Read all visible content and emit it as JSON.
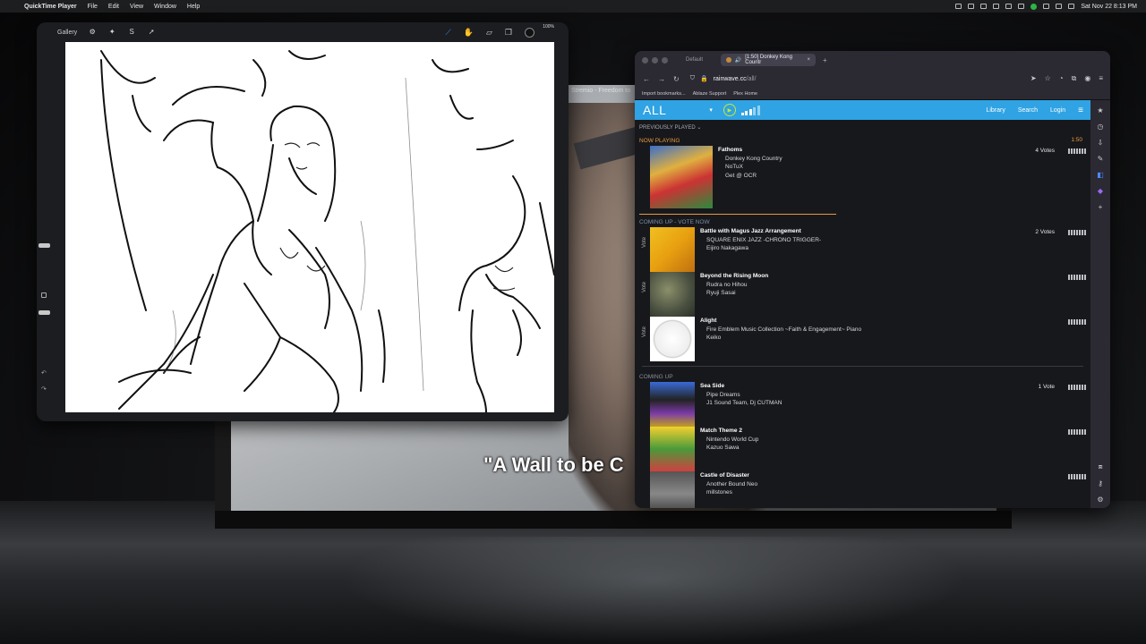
{
  "menubar": {
    "app": "QuickTime Player",
    "items": [
      "File",
      "Edit",
      "View",
      "Window",
      "Help"
    ],
    "clock": "Sat Nov 22  8:13 PM"
  },
  "video": {
    "title": "Stremio - Freedom to",
    "subtitle": "\"A Wall to be C"
  },
  "procreate": {
    "gallery": "Gallery",
    "battery": "100%"
  },
  "browser": {
    "tabs": [
      {
        "label": "Default"
      },
      {
        "label": "[1:50] Donkey Kong Countr"
      }
    ],
    "url_host": "rainwave.cc",
    "url_path": "/all/",
    "bookmarks": [
      "Import bookmarks...",
      "Ablaze Support",
      "Plex Home"
    ]
  },
  "site": {
    "station": "ALL",
    "nav": [
      "Library",
      "Search",
      "Login"
    ],
    "previously_played": "PREVIOUSLY PLAYED",
    "now_playing_label": "NOW PLAYING",
    "timer": "1:50",
    "coming_up_vote_label": "COMING UP - VOTE NOW",
    "coming_up_label": "COMING UP",
    "vote_label": "Vote",
    "now_playing": {
      "title": "Fathoms",
      "album": "Donkey Kong Country",
      "artist": "NoTuX",
      "extra": "Get @ OCR",
      "votes": "4 Votes"
    },
    "vote_now": [
      {
        "title": "Battle with Magus Jazz Arrangement",
        "album": "SQUARE ENIX JAZZ -CHRONO TRIGGER-",
        "artist": "Eijiro Nakagawa",
        "votes": "2 Votes"
      },
      {
        "title": "Beyond the Rising Moon",
        "album": "Rudra no Hihou",
        "artist": "Ryuji Sasai",
        "votes": ""
      },
      {
        "title": "Alight",
        "album": "Fire Emblem Music Collection ~Faith & Engagement~ Piano",
        "artist": "Keiko",
        "votes": ""
      }
    ],
    "coming_up": [
      {
        "title": "Sea Side",
        "album": "Pipe Dreams",
        "artist": "J1 Sound Team, Dj CUTMAN",
        "votes": "1 Vote"
      },
      {
        "title": "Match Theme 2",
        "album": "Nintendo World Cup",
        "artist": "Kazuo Sawa",
        "votes": ""
      },
      {
        "title": "Castle of Disaster",
        "album": "Another Bound Neo",
        "artist": "millstones",
        "votes": ""
      }
    ]
  }
}
